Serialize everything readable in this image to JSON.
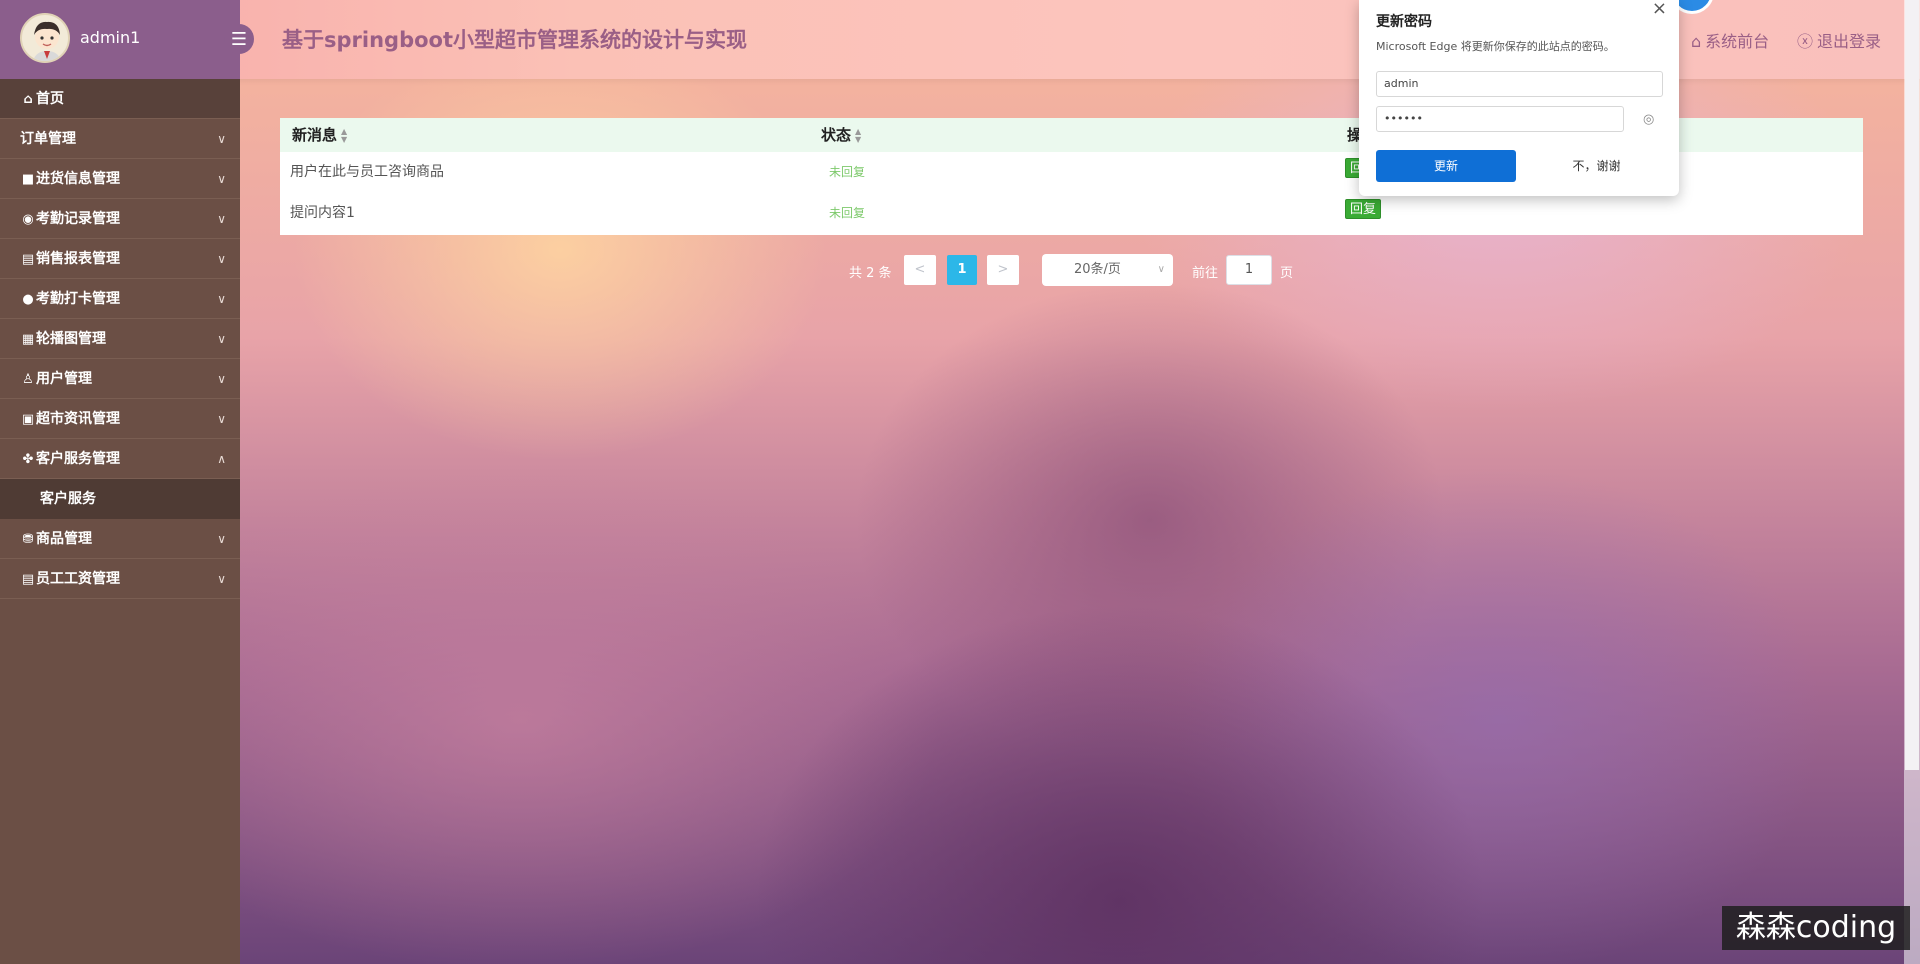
{
  "header": {
    "username": "admin1",
    "site_title": "基于springboot小型超市管理系统的设计与实现",
    "front_link": "系统前台",
    "logout_link": "退出登录"
  },
  "sidebar": {
    "items": [
      {
        "label": "首页",
        "icon": "home-icon"
      },
      {
        "label": "订单管理",
        "icon": "none"
      },
      {
        "label": "进货信息管理",
        "icon": "square-icon"
      },
      {
        "label": "考勤记录管理",
        "icon": "record-icon"
      },
      {
        "label": "销售报表管理",
        "icon": "report-icon"
      },
      {
        "label": "考勤打卡管理",
        "icon": "circle-icon"
      },
      {
        "label": "轮播图管理",
        "icon": "image-icon"
      },
      {
        "label": "用户管理",
        "icon": "user-icon"
      },
      {
        "label": "超市资讯管理",
        "icon": "news-icon"
      },
      {
        "label": "客户服务管理",
        "icon": "service-icon",
        "expanded": true
      },
      {
        "label": "商品管理",
        "icon": "goods-icon"
      },
      {
        "label": "员工工资管理",
        "icon": "salary-icon"
      }
    ],
    "sub_item": "客户服务"
  },
  "table": {
    "columns": [
      "新消息",
      "状态",
      "操作"
    ],
    "rows": [
      {
        "message": "用户在此与员工咨询商品",
        "status": "未回复",
        "action": "回复"
      },
      {
        "message": "提问内容1",
        "status": "未回复",
        "action": "回复"
      }
    ]
  },
  "pagination": {
    "total": "共 2 条",
    "prev": "<",
    "page": "1",
    "next": ">",
    "page_size": "20条/页",
    "goto_label": "前往",
    "goto_value": "1",
    "page_unit": "页"
  },
  "popup": {
    "title": "更新密码",
    "description": "Microsoft Edge 将更新你保存的此站点的密码。",
    "username_value": "admin",
    "password_value": "••••••",
    "update_label": "更新",
    "decline_label": "不，谢谢"
  },
  "watermark": "森森coding",
  "colors": {
    "brand": "#8b5e8c",
    "sidebar": "#6b4f45",
    "accent": "#2cb7e8",
    "status_green": "#7dc96b",
    "reply_green": "#3aab35",
    "edge_blue": "#0f6fd6"
  }
}
